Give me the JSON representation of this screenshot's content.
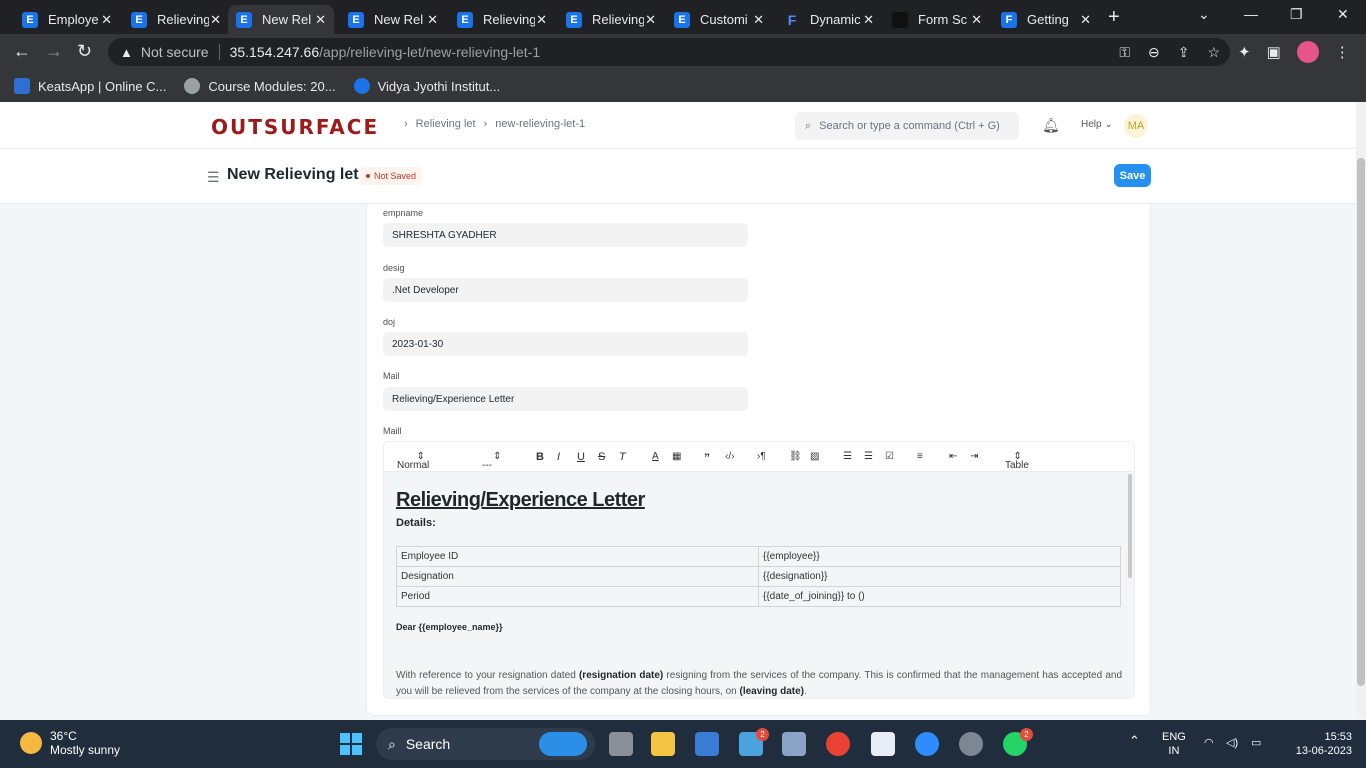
{
  "browser": {
    "tabs": [
      {
        "label": "Employe",
        "icon": "E"
      },
      {
        "label": "Relieving",
        "icon": "E"
      },
      {
        "label": "New Rel",
        "icon": "E",
        "active": true
      },
      {
        "label": "New Rel",
        "icon": "E"
      },
      {
        "label": "Relieving",
        "icon": "E"
      },
      {
        "label": "Relieving",
        "icon": "E"
      },
      {
        "label": "Customi",
        "icon": "E"
      },
      {
        "label": "Dynamic",
        "icon": "F"
      },
      {
        "label": "Form Sc",
        "icon": ""
      },
      {
        "label": "Getting",
        "icon": "F"
      }
    ],
    "security_label": "Not secure",
    "url_host": "35.154.247.66",
    "url_path": "/app/relieving-let/new-relieving-let-1",
    "bookmarks": [
      {
        "label": "KeatsApp | Online C...",
        "color": "#2f6fd1"
      },
      {
        "label": "Course Modules: 20...",
        "color": "#9aa0a6"
      },
      {
        "label": "Vidya Jyothi Institut...",
        "color": "#1a73e8"
      }
    ]
  },
  "app": {
    "logo": "OUTSURFACE",
    "breadcrumbs": [
      "Relieving let",
      "new-relieving-let-1"
    ],
    "search_placeholder": "Search or type a command (Ctrl + G)",
    "help_label": "Help",
    "avatar_initials": "MA",
    "page_title": "New Relieving let",
    "status": "Not Saved",
    "save_label": "Save"
  },
  "form": {
    "fields": [
      {
        "label": "empname",
        "value": "SHRESHTA  GYADHER"
      },
      {
        "label": "desig",
        "value": ".Net Developer"
      },
      {
        "label": "doj",
        "value": "2023-01-30"
      },
      {
        "label": "Mail",
        "value": "Relieving/Experience Letter"
      }
    ],
    "editor_label": "Maill",
    "toolbar": {
      "style_select": "Normal",
      "size_select": "---",
      "table_select": "Table"
    },
    "letter": {
      "title": "Relieving/Experience Letter",
      "details_heading": "Details:",
      "table_rows": [
        [
          "Employee ID",
          "{{employee}}"
        ],
        [
          "Designation",
          "{{designation}}"
        ],
        [
          "Period",
          "{{date_of_joining}} to ()"
        ]
      ],
      "salutation": "Dear {{employee_name}}",
      "para_1": "With reference to your resignation dated",
      "para_b1": "(resignation date)",
      "para_2": "resigning from the services of the company. This is confirmed that the management has accepted and you will be relieved from the services of the company at the closing hours, on",
      "para_b2": "(leaving date)",
      "para_3": "."
    }
  },
  "taskbar": {
    "temperature": "36°C",
    "weather": "Mostly sunny",
    "search_label": "Search",
    "mail_badge": "2",
    "whatsapp_badge": "2",
    "language": "ENG",
    "region": "IN",
    "time": "15:53",
    "date": "13-06-2023"
  }
}
